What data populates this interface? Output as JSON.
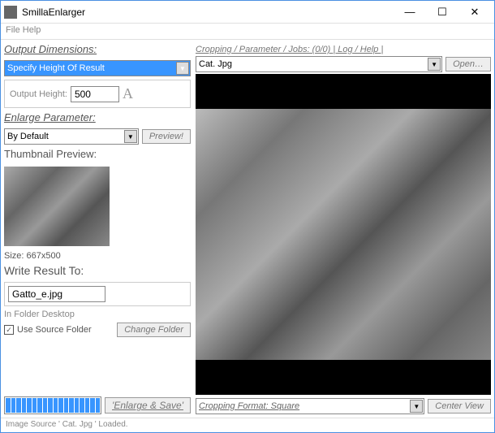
{
  "window": {
    "title": "SmillaEnlarger"
  },
  "menu": {
    "items": "File Help"
  },
  "left": {
    "outputDimLabel": "Output Dimensions:",
    "specifyMode": "Specify Height Of Result",
    "outputHeightLabel": "Output Height:",
    "outputHeightValue": "500",
    "enlargeParamLabel": "Enlarge Parameter:",
    "paramMode": "By Default",
    "previewBtn": "Preview!",
    "thumbLabel": "Thumbnail Preview:",
    "thumbSize": "Size: 667x500",
    "writeLabel": "Write Result To:",
    "outFilename": "Gatto_e.jpg",
    "inFolder": "In Folder Desktop",
    "useSourceFolder": "Use Source Folder",
    "changeFolderBtn": "Change Folder",
    "enlargeSaveBtn": "'Enlarge & Save'"
  },
  "right": {
    "tabs": "Cropping / Parameter / Jobs: (0/0) | Log / Help |",
    "currentFile": "Cat. Jpg",
    "openBtn": "Open…",
    "cropFormatLabel": "Cropping Format: Square",
    "centerViewBtn": "Center View"
  },
  "status": "Image Source ' Cat. Jpg ' Loaded."
}
